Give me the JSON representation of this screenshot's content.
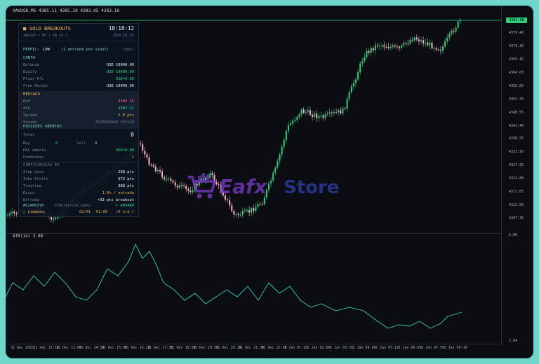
{
  "chart": {
    "symbol_line": "XAUUSD,M5   4385.11  4385.28  4383.05  4383.16",
    "atr_label": "ATR(14) 3.80",
    "current_price": "4384.98",
    "price_ticks": [
      "4379.40",
      "4374.30",
      "4369.15",
      "4364.00",
      "4358.85",
      "4353.70",
      "4348.55",
      "4343.40",
      "4338.25",
      "4333.10",
      "4327.95",
      "4322.80",
      "4317.65",
      "4312.50",
      "4307.35"
    ],
    "atr_ticks": [
      "5.66",
      "2.04"
    ],
    "time_ticks": [
      "31 Dec 2025",
      "31 Dec 12:10",
      "31 Dec 13:00",
      "31 Dec 14:50",
      "31 Dec 15:00",
      "31 Dec 16:10",
      "31 Dec 17:30",
      "31 Dec 18:50",
      "31 Dec 19:50",
      "31 Dec 20:10",
      "31 Dec 21:30",
      "31 Dec 22:50",
      "2 Jan 01:10",
      "2 Jan 02:00",
      "2 Jan 03:50",
      "2 Jan 04:00",
      "2 Jan 05:10",
      "2 Jan 06:00",
      "2 Jan 07:50",
      "2 Jan 09:10"
    ],
    "colors": {
      "up": "#2bd07c",
      "down": "#f7b2c2",
      "atr_line": "#2fd1b3",
      "background": "#0b0d12"
    }
  },
  "panel": {
    "title": "GOLD BREAKOUTS",
    "clock": "10:18:12",
    "subtitle": "XAUUSD  •  M5  •  EA v3.1",
    "date": "2026.01.02",
    "profile_label": "PERFIL:",
    "profile_value": "LOW",
    "profile_note": "(1 entrada por sinal)",
    "profile_right": "Label",
    "conta": {
      "title": "CONTA",
      "rows": [
        {
          "label": "Balance",
          "value": "USD 10000.00"
        },
        {
          "label": "Equity",
          "value": "USD 10000.00"
        },
        {
          "label": "Float P/L",
          "value": "USD+0.00"
        },
        {
          "label": "Free Margin",
          "value": "USD 10000.00"
        }
      ]
    },
    "mercado": {
      "title": "MERCADO",
      "rows": [
        {
          "label": "Bid",
          "value": "4383.16"
        },
        {
          "label": "Ask",
          "value": "4383.21"
        },
        {
          "label": "Spread",
          "value": "5.0 pts"
        },
        {
          "label": "Sessão",
          "value": "AGUARDANDO SESSÃO"
        }
      ]
    },
    "posicoes": {
      "title": "POSIÇÕES ABERTAS",
      "total_label": "Total",
      "total_value": "0",
      "buy_label": "Buy",
      "buy_value": "0",
      "sell_label": "Sell",
      "sell_value": "0",
      "pl_label": "P&L aberto",
      "pl_value": "USD+0.00",
      "pend_label": "Pendentes",
      "pend_value": "0"
    },
    "config": {
      "title": "CONFIGURAÇÃO EA",
      "rows": [
        {
          "label": "Stop Loss",
          "value": "208 pts"
        },
        {
          "label": "Take Profit",
          "value": "672 pts"
        },
        {
          "label": "Trailing",
          "value": "388 pts"
        },
        {
          "label": "Risco",
          "value": "1.0% / entrada"
        },
        {
          "label": "Entrada",
          "value": "+33 pts breakout"
        }
      ]
    },
    "footer": {
      "account": "#52406378",
      "server": "ICMarketsSC-Demo",
      "status": "• ABUARD",
      "limpeza_label": "△ Limpeza:",
      "limpeza_date": "02/01",
      "limpeza_time": "01:00",
      "limpeza_orders": "(0 ord.)"
    }
  },
  "watermark": {
    "brand_a": "Eafx",
    "brand_b": "Store"
  }
}
